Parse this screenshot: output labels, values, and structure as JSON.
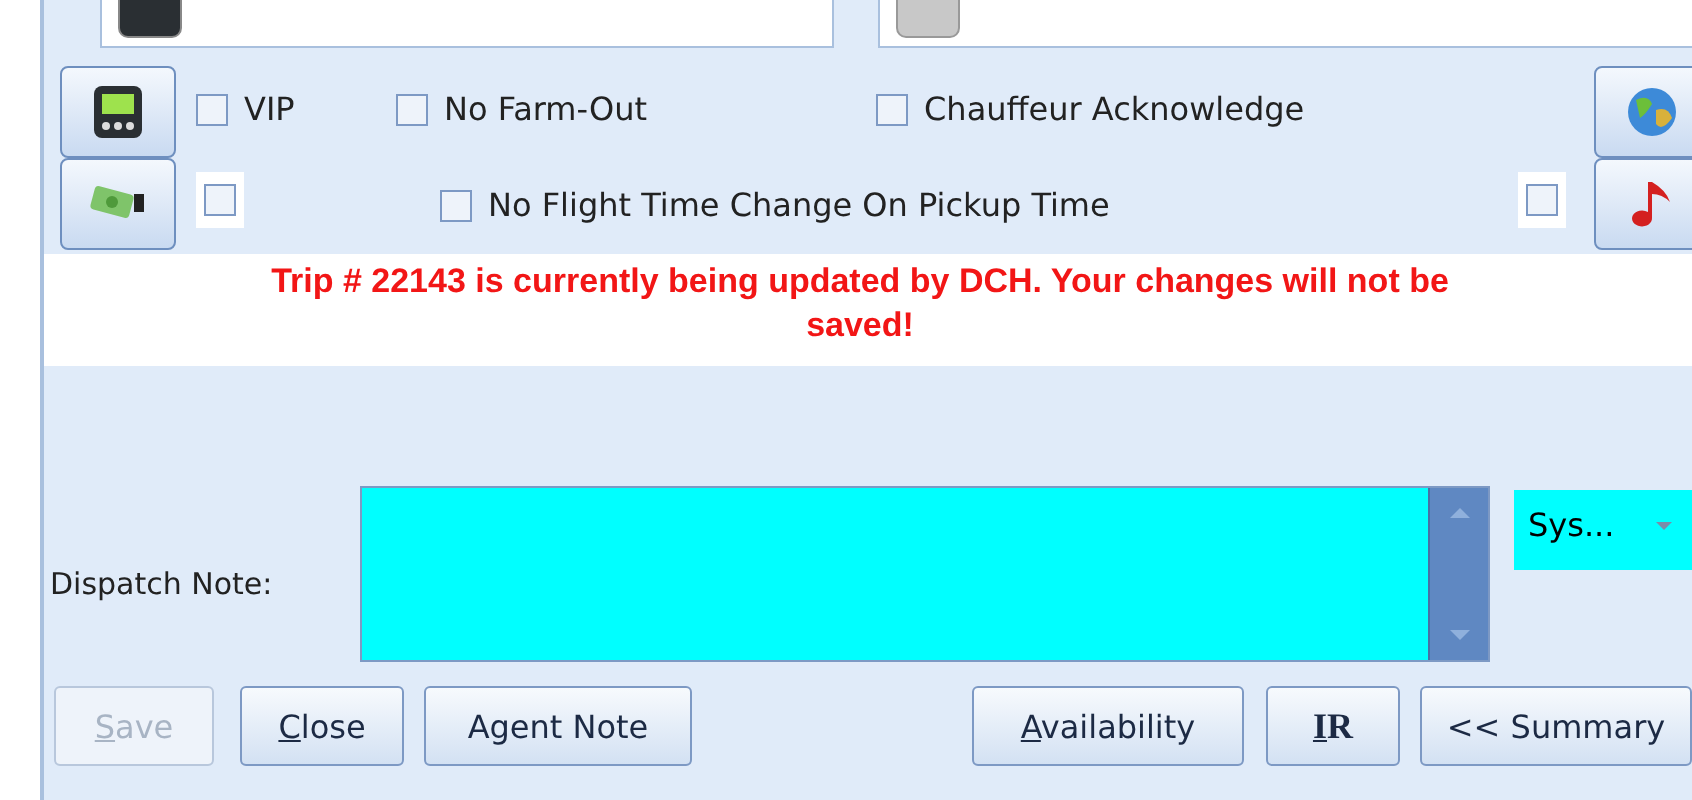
{
  "row_1": {
    "checkboxes": [
      {
        "label": "VIP",
        "checked": false
      },
      {
        "label": "No Farm-Out",
        "checked": false
      },
      {
        "label": "Chauffeur Acknowledge",
        "checked": false
      }
    ]
  },
  "row_2": {
    "checkboxes": [
      {
        "checked": false
      },
      {
        "label": "No Flight Time Change On Pickup Time",
        "checked": false
      },
      {
        "checked": false
      }
    ]
  },
  "warning": {
    "line_1": "Trip # 22143 is currently being updated by DCH. Your changes will not be",
    "line_2": "saved!"
  },
  "dispatch_note": {
    "label": "Dispatch Note:",
    "dropdown": "Sys..."
  },
  "buttons": [
    {
      "mnemonic": "S",
      "rest": "ave",
      "disabled": true
    },
    {
      "mnemonic": "C",
      "rest": "lose",
      "disabled": false
    },
    {
      "rest": "Agent Note",
      "disabled": false
    },
    {
      "mnemonic": "A",
      "rest": "vailability",
      "disabled": false
    },
    {
      "mnemonic": "I",
      "rest": "R",
      "disabled": false
    },
    {
      "rest": "<< Summary",
      "disabled": false
    }
  ]
}
